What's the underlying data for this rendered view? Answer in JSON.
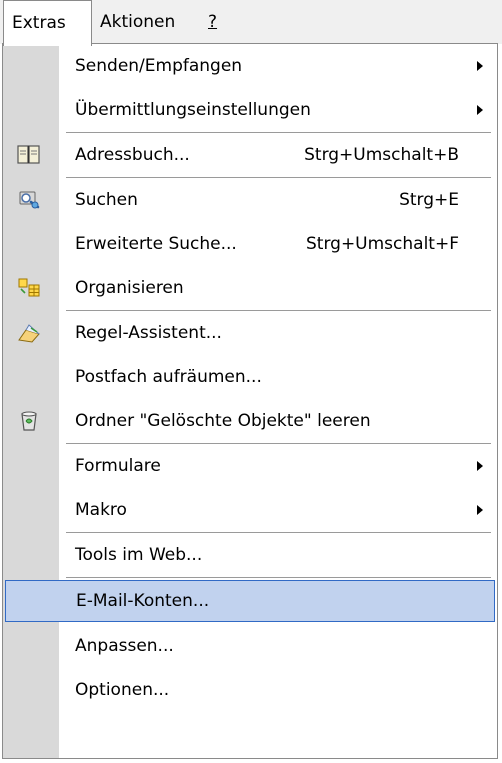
{
  "menubar": {
    "extras": "Extras",
    "aktionen": "Aktionen",
    "help": "?"
  },
  "menu": {
    "items": [
      {
        "label": "Senden/Empfangen",
        "submenu": true
      },
      {
        "label": "Übermittlungseinstellungen",
        "submenu": true
      },
      {
        "label": "Adressbuch...",
        "shortcut": "Strg+Umschalt+B",
        "icon": "address-book-icon"
      },
      {
        "label": "Suchen",
        "shortcut": "Strg+E",
        "icon": "search-icon"
      },
      {
        "label": "Erweiterte Suche...",
        "shortcut": "Strg+Umschalt+F"
      },
      {
        "label": "Organisieren",
        "icon": "organize-icon"
      },
      {
        "label": "Regel-Assistent...",
        "icon": "rules-wizard-icon"
      },
      {
        "label": "Postfach aufräumen..."
      },
      {
        "label": "Ordner \"Gelöschte Objekte\" leeren",
        "icon": "empty-trash-icon"
      },
      {
        "label": "Formulare",
        "submenu": true
      },
      {
        "label": "Makro",
        "submenu": true
      },
      {
        "label": "Tools im Web..."
      },
      {
        "label": "E-Mail-Konten...",
        "highlighted": true
      },
      {
        "label": "Anpassen..."
      },
      {
        "label": "Optionen..."
      }
    ]
  },
  "colors": {
    "highlight_fill": "#c1d2ee",
    "highlight_border": "#316ac5",
    "icon_strip": "#d9d9d9"
  }
}
